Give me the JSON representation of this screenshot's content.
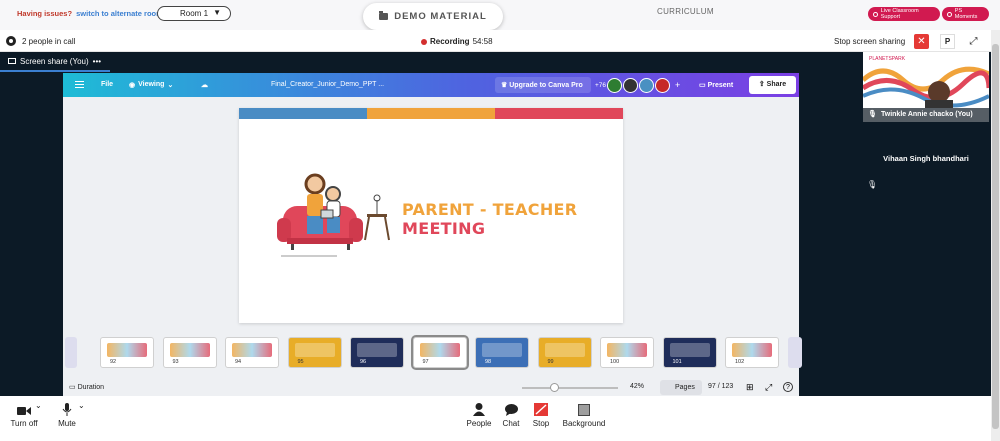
{
  "topbar": {
    "issues_text": "Having issues?",
    "alt_room_link": "switch to alternate room",
    "room_value": "Room 1",
    "demo_material": "DEMO MATERIAL",
    "curriculum": "CURRICULUM",
    "live_support": "Live Classroom Support",
    "ps_moments": "PS Moments"
  },
  "callbar": {
    "people_count": "2 people in call",
    "recording_label": "Recording",
    "recording_time": "54:58",
    "stop_sharing": "Stop screen sharing",
    "p_label": "P"
  },
  "stage": {
    "share_tab": "Screen share (You)",
    "share_tab_more": "•••"
  },
  "canva": {
    "file": "File",
    "viewing": "Viewing",
    "doc_title": "Final_Creator_Junior_Demo_PPT ...",
    "upgrade": "Upgrade to Canva Pro",
    "collab_count": "+76",
    "present": "Present",
    "share": "Share",
    "slide": {
      "title_line1": "PARENT - TEACHER",
      "title_line2": "MEETING"
    },
    "thumbnails": [
      {
        "num": "92",
        "selected": false,
        "color": "#ffffff"
      },
      {
        "num": "93",
        "selected": false,
        "color": "#ffffff"
      },
      {
        "num": "94",
        "selected": false,
        "color": "#ffffff"
      },
      {
        "num": "95",
        "selected": false,
        "color": "#e8ad28"
      },
      {
        "num": "96",
        "selected": false,
        "color": "#1f2d5a"
      },
      {
        "num": "97",
        "selected": true,
        "color": "#ffffff"
      },
      {
        "num": "98",
        "selected": false,
        "color": "#3c6fb6"
      },
      {
        "num": "99",
        "selected": false,
        "color": "#e8ad28"
      },
      {
        "num": "100",
        "selected": false,
        "color": "#ffffff"
      },
      {
        "num": "101",
        "selected": false,
        "color": "#1f2d5a"
      },
      {
        "num": "102",
        "selected": false,
        "color": "#ffffff"
      }
    ],
    "duration": "Duration",
    "zoom": "42%",
    "zoom_level": 0.34,
    "pages": "Pages",
    "page_count": "97 / 123"
  },
  "participants": [
    {
      "name": "Twinkle Annie chacko (You)"
    },
    {
      "name": "Vihaan Singh bhandhari"
    }
  ],
  "toolbar": {
    "turn_off": "Turn off",
    "mute": "Mute",
    "people": "People",
    "chat": "Chat",
    "stop": "Stop",
    "background": "Background"
  },
  "colors": {
    "accent_red": "#d11a50",
    "canva_gradient_start": "#1ebcd6",
    "canva_gradient_end": "#7b3fe4",
    "title_orange": "#f0a33b",
    "title_pink": "#e0475a",
    "stage_bg": "#0c1a26"
  }
}
